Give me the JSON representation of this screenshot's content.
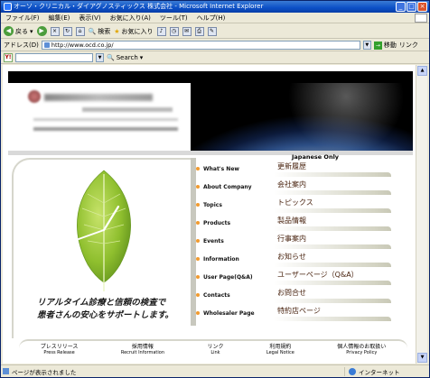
{
  "window": {
    "title": "オーソ・クリニカル・ダイアグノスティックス 株式会社 - Microsoft Internet Explorer",
    "minimize": "_",
    "maximize": "□",
    "close": "×"
  },
  "menubar": [
    "ファイル(F)",
    "編集(E)",
    "表示(V)",
    "お気に入り(A)",
    "ツール(T)",
    "ヘルプ(H)"
  ],
  "toolbar": {
    "back": "戻る",
    "search": "検索",
    "favorites": "お気に入り"
  },
  "address": {
    "label": "アドレス(D)",
    "url": "http://www.ocd.co.jp/",
    "go": "移動",
    "links": "リンク"
  },
  "searchbar": {
    "label": "Search"
  },
  "page": {
    "japanese_only": "Japanese Only",
    "slogan_line1": "リアルタイム診療と信頼の検査で",
    "slogan_line2": "患者さんの安心をサポートします。",
    "nav_en": [
      "What's New",
      "About Company",
      "Topics",
      "Products",
      "Events",
      "Information",
      "User Page(Q&A)",
      "Contacts",
      "Wholesaler Page"
    ],
    "nav_jp": [
      "更新履歴",
      "会社案内",
      "トピックス",
      "製品情報",
      "行事案内",
      "お知らせ",
      "ユーザーページ（Q&A）",
      "お問合せ",
      "特約店ページ"
    ],
    "footer": [
      {
        "jp": "プレスリリース",
        "en": "Press Release"
      },
      {
        "jp": "採用情報",
        "en": "Recruit Information"
      },
      {
        "jp": "リンク",
        "en": "Link"
      },
      {
        "jp": "利用規約",
        "en": "Legal Notice"
      },
      {
        "jp": "個人情報のお取扱い",
        "en": "Privacy Policy"
      }
    ]
  },
  "status": {
    "text": "ページが表示されました",
    "zone": "インターネット"
  },
  "colors": {
    "titlebar": "#0b4fc6",
    "nav_dot": "#f29b2f",
    "jp_text": "#4a2410"
  }
}
